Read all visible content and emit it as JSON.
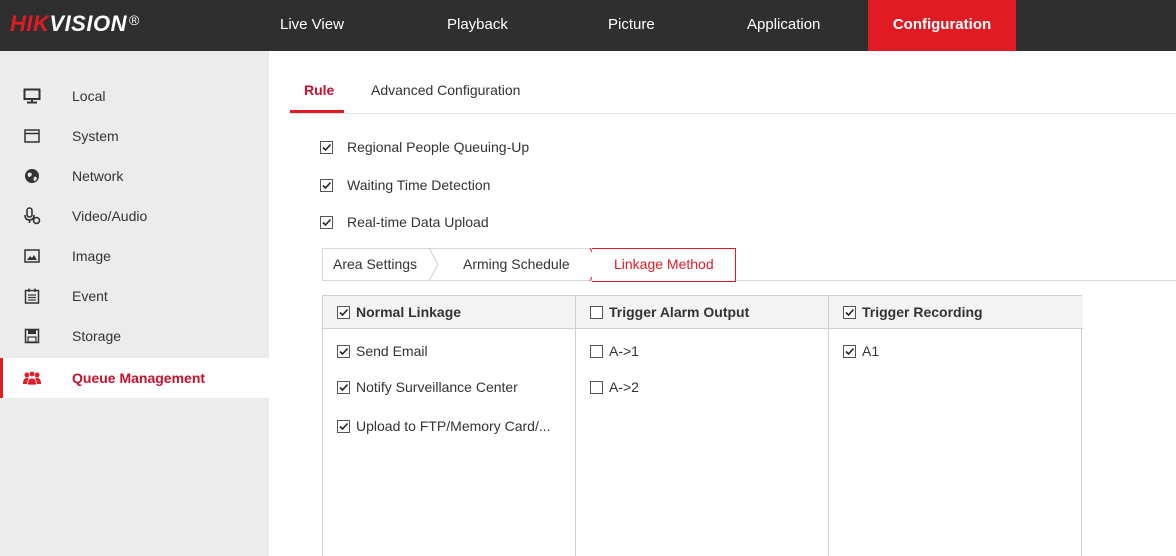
{
  "header": {
    "logo_brand_red": "HIK",
    "logo_brand_white": "VISION",
    "logo_reg": "®",
    "nav": [
      {
        "label": "Live View"
      },
      {
        "label": "Playback"
      },
      {
        "label": "Picture"
      },
      {
        "label": "Application"
      },
      {
        "label": "Configuration",
        "active": true
      }
    ]
  },
  "sidebar": {
    "items": [
      {
        "label": "Local",
        "icon": "monitor-icon"
      },
      {
        "label": "System",
        "icon": "window-icon"
      },
      {
        "label": "Network",
        "icon": "globe-icon"
      },
      {
        "label": "Video/Audio",
        "icon": "microphone-icon"
      },
      {
        "label": "Image",
        "icon": "image-icon"
      },
      {
        "label": "Event",
        "icon": "calendar-icon"
      },
      {
        "label": "Storage",
        "icon": "floppy-icon"
      },
      {
        "label": "Queue Management",
        "icon": "people-icon",
        "active": true
      }
    ]
  },
  "subtabs": [
    {
      "label": "Rule",
      "active": true
    },
    {
      "label": "Advanced Configuration"
    }
  ],
  "options": [
    {
      "label": "Regional People Queuing-Up",
      "checked": true
    },
    {
      "label": "Waiting Time Detection",
      "checked": true
    },
    {
      "label": "Real-time Data Upload",
      "checked": true
    }
  ],
  "steps": [
    {
      "label": "Area Settings"
    },
    {
      "label": "Arming Schedule"
    },
    {
      "label": "Linkage Method",
      "active": true
    }
  ],
  "linkage": {
    "normal": {
      "header": "Normal Linkage",
      "checked": true,
      "items": [
        {
          "label": "Send Email",
          "checked": true
        },
        {
          "label": "Notify Surveillance Center",
          "checked": true
        },
        {
          "label": "Upload to FTP/Memory Card/...",
          "checked": true
        }
      ]
    },
    "alarm_output": {
      "header": "Trigger Alarm Output",
      "checked": false,
      "items": [
        {
          "label": "A->1",
          "checked": false
        },
        {
          "label": "A->2",
          "checked": false
        }
      ]
    },
    "recording": {
      "header": "Trigger Recording",
      "checked": true,
      "items": [
        {
          "label": "A1",
          "checked": true
        }
      ]
    }
  },
  "colors": {
    "accent": "#e01b24",
    "topbar": "#2f2f2f",
    "sidebar": "#ececec"
  }
}
